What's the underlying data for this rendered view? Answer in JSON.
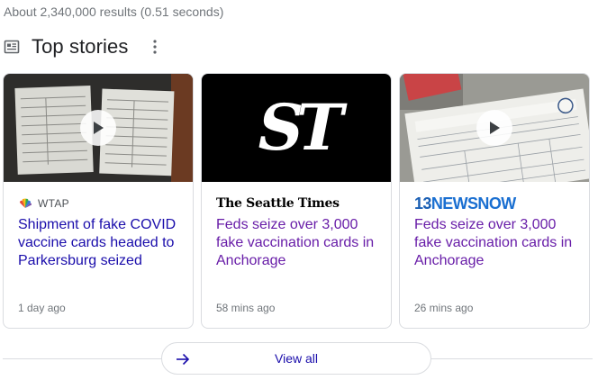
{
  "results": {
    "count_text": "About 2,340,000 results (0.51 seconds)"
  },
  "top_stories": {
    "title": "Top stories",
    "icon": "news-icon",
    "more_icon": "more-vert-icon"
  },
  "cards": [
    {
      "source": "WTAP",
      "source_icon": "nbc-peacock-icon",
      "headline": "Shipment of fake COVID vaccine cards headed to Parkersburg seized",
      "time": "1 day ago",
      "has_video": true,
      "link_color": "#1a0dab"
    },
    {
      "source": "The Seattle Times",
      "source_logo_text": "The Seattle Times",
      "thumbnail_logo_text": "ST",
      "headline": "Feds seize over 3,000 fake vaccination cards in Anchorage",
      "time": "58 mins ago",
      "has_video": false,
      "link_color": "#681da8"
    },
    {
      "source": "13 News Now",
      "source_logo_num": "13",
      "source_logo_word": "NEWSNOW",
      "headline": "Feds seize over 3,000 fake vaccination cards in Anchorage",
      "time": "26 mins ago",
      "has_video": true,
      "link_color": "#681da8"
    }
  ],
  "view_all": {
    "label": "View all",
    "icon": "arrow-right-icon"
  }
}
